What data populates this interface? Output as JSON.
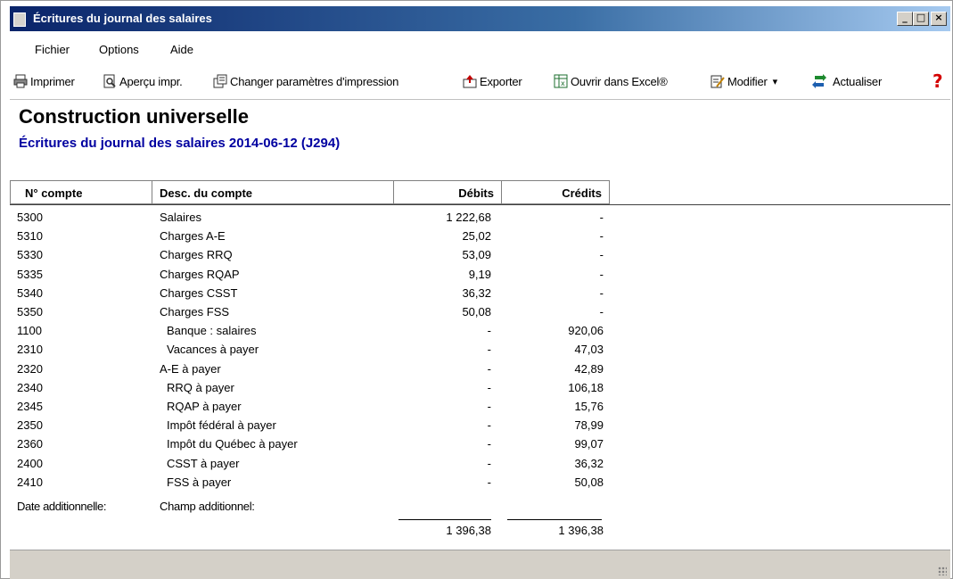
{
  "window": {
    "title": "Écritures du journal des salaires",
    "minimize": "_",
    "maximize": "□",
    "close": "×"
  },
  "menu": [
    "Fichier",
    "Options",
    "Aide"
  ],
  "toolbar": {
    "print": "Imprimer",
    "preview": "Aperçu impr.",
    "print_settings": "Changer paramètres d'impression",
    "export": "Exporter",
    "excel": "Ouvrir dans Excel®",
    "modify": "Modifier",
    "modify_arrow": "▾",
    "refresh": "Actualiser",
    "help": "?"
  },
  "report": {
    "company": "Construction universelle",
    "subtitle": "Écritures du journal des salaires 2014-06-12 (J294)",
    "headers": {
      "account": "N° compte",
      "desc": "Desc. du compte",
      "debits": "Débits",
      "credits": "Crédits"
    },
    "rows": [
      {
        "account": "5300",
        "desc": "Salaires",
        "debit": "1 222,68",
        "credit": "-"
      },
      {
        "account": "5310",
        "desc": "Charges A-E",
        "debit": "25,02",
        "credit": "-"
      },
      {
        "account": "5330",
        "desc": "Charges RRQ",
        "debit": "53,09",
        "credit": "-"
      },
      {
        "account": "5335",
        "desc": "Charges RQAP",
        "debit": "9,19",
        "credit": "-"
      },
      {
        "account": "5340",
        "desc": "Charges CSST",
        "debit": "36,32",
        "credit": "-"
      },
      {
        "account": "5350",
        "desc": "Charges FSS",
        "debit": "50,08",
        "credit": "-"
      },
      {
        "account": "1100",
        "desc": "Banque : salaires",
        "debit": "-",
        "credit": "920,06"
      },
      {
        "account": "2310",
        "desc": "Vacances à payer",
        "debit": "-",
        "credit": "47,03"
      },
      {
        "account": "2320",
        "desc": "A-E à payer",
        "debit": "-",
        "credit": "42,89"
      },
      {
        "account": "2340",
        "desc": "RRQ à payer",
        "debit": "-",
        "credit": "106,18"
      },
      {
        "account": "2345",
        "desc": "RQAP à payer",
        "debit": "-",
        "credit": "15,76"
      },
      {
        "account": "2350",
        "desc": "Impôt fédéral à payer",
        "debit": "-",
        "credit": "78,99"
      },
      {
        "account": "2360",
        "desc": "Impôt du Québec à payer",
        "debit": "-",
        "credit": "99,07"
      },
      {
        "account": "2400",
        "desc": "CSST à payer",
        "debit": "-",
        "credit": "36,32"
      },
      {
        "account": "2410",
        "desc": "FSS à payer",
        "debit": "-",
        "credit": "50,08"
      }
    ],
    "extra_date_label": "Date additionnelle:",
    "extra_field_label": "Champ additionnel:",
    "total_debits": "1 396,38",
    "total_credits": "1 396,38"
  }
}
